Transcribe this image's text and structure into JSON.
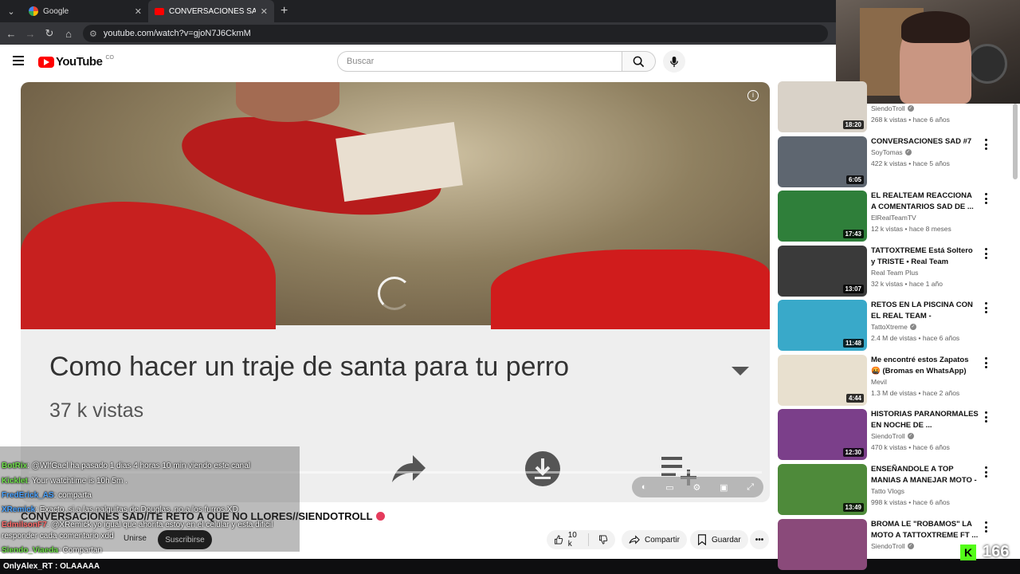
{
  "browser": {
    "tabs": [
      {
        "title": "Google",
        "favicon": "google-icon"
      },
      {
        "title": "CONVERSACIONES SAD//TE RE",
        "favicon": "youtube-icon"
      }
    ],
    "url": "youtube.com/watch?v=gjoN7J6CkmM"
  },
  "youtube": {
    "logo_text": "YouTube",
    "country": "CO",
    "search_placeholder": "Buscar"
  },
  "video": {
    "frame_text": "Como hacer un traje de santa para tu perro",
    "frame_views": "37 k vistas",
    "title": "CONVERSACIONES SAD//TE RETO A QUE NO LLORES//SIENDOTROLL",
    "join_label": "Unirse",
    "subscribe_label": "Suscribirse",
    "likes": "10 k",
    "share_label": "Compartir",
    "save_label": "Guardar"
  },
  "chat": [
    {
      "user": "BotRix",
      "text": ": @WlfGael ha pasado 1 dias 4 horas 10 min viendo este canal",
      "color": "#6fe04a"
    },
    {
      "user": "Kicklet",
      "text": ": Your watchtime is 10h 5m .",
      "color": "#6fe04a"
    },
    {
      "user": "FredErick_AS",
      "text": ": comparta",
      "color": "#4aa3ff"
    },
    {
      "user": "XRemick",
      "text": ": Exacto, si a las nalguitas de Douglas, no a los furros XD",
      "color": "#4aa3ff"
    },
    {
      "user": "EdmilsonF7",
      "text": ": @XRemick yo igual que ahorita estoy en el celular y esta dificil",
      "color": "#ff6b6b"
    },
    {
      "user": "",
      "text": "responder cada comentario xdd",
      "color": "#ffffff"
    },
    {
      "user": "Siendo_Viaeda",
      "text": ": Compartan",
      "color": "#6fe04a"
    }
  ],
  "chat_bottom": "OnlyAlex_RT : OLAAAAA",
  "kick_viewers": "166",
  "recommendations": [
    {
      "title": "",
      "channel": "SiendoTroll",
      "verified": true,
      "meta": "268 k vistas • hace 6 años",
      "duration": "18:20",
      "thumb": "#d9d2c8"
    },
    {
      "title": "CONVERSACIONES  SAD #7",
      "channel": "SoyTomas",
      "verified": true,
      "meta": "422 k vistas • hace 5 años",
      "duration": "6:05",
      "thumb": "#5e6670"
    },
    {
      "title": "EL REALTEAM REACCIONA A COMENTARIOS SAD DE ...",
      "channel": "ElRealTeamTV",
      "verified": false,
      "meta": "12 k vistas • hace 8 meses",
      "duration": "17:43",
      "thumb": "#2f7f3a"
    },
    {
      "title": "TATTOXTREME Está Soltero y TRISTE • Real Team Podcast",
      "channel": "Real Team Plus",
      "verified": false,
      "meta": "32 k vistas • hace 1 año",
      "duration": "13:07",
      "thumb": "#3a3a3a"
    },
    {
      "title": "RETOS EN LA PISCINA CON EL REAL TEAM - TATTOXTREME",
      "channel": "TattoXtreme",
      "verified": true,
      "meta": "2.4 M de vistas • hace 6 años",
      "duration": "11:48",
      "thumb": "#39a9c9"
    },
    {
      "title": "Me encontré estos Zapatos 🤬 (Bromas en WhatsApp)",
      "channel": "Mevil",
      "verified": false,
      "meta": "1.3 M de vistas • hace 2 años",
      "duration": "4:44",
      "thumb": "#e8e0cf"
    },
    {
      "title": "HISTORIAS PARANORMALES EN NOCHE DE ...",
      "channel": "SiendoTroll",
      "verified": true,
      "meta": "470 k vistas • hace 6 años",
      "duration": "12:30",
      "thumb": "#7b3f8a"
    },
    {
      "title": "ENSEÑANDOLE A TOP MANIAS A MANEJAR MOTO - TATTO ...",
      "channel": "Tatto Vlogs",
      "verified": false,
      "meta": "998 k vistas • hace 6 años",
      "duration": "13:49",
      "thumb": "#4e8a3a"
    },
    {
      "title": "BROMA LE \"ROBAMOS\" LA MOTO A TATTOXTREME FT ...",
      "channel": "SiendoTroll",
      "verified": true,
      "meta": "",
      "duration": "",
      "thumb": "#8a4a7a"
    }
  ]
}
